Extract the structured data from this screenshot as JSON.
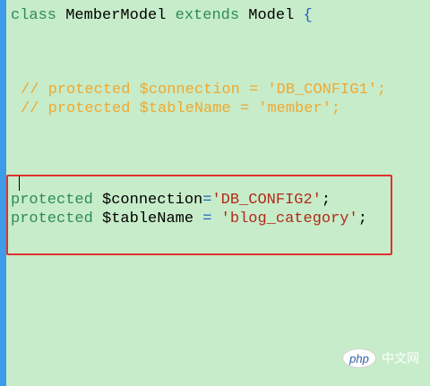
{
  "editor": {
    "line1": {
      "kw_class": "class",
      "name": "MemberModel",
      "kw_extends": "extends",
      "parent": "Model",
      "brace": "{"
    },
    "comment1": "// protected $connection = 'DB_CONFIG1';",
    "comment2": "// protected $tableName = 'member';",
    "code1": {
      "kw": "protected",
      "var": "$connection",
      "op": "=",
      "str": "'DB_CONFIG2'",
      "end": ";"
    },
    "code2": {
      "kw": "protected",
      "var": "$tableName",
      "op": "=",
      "str": "'blog_category'",
      "end": ";"
    }
  },
  "watermark": {
    "badge": "php",
    "text": "中文网"
  },
  "colors": {
    "background": "#c7ecc9",
    "gutter": "#3d9be9",
    "keyword": "#2e8b57",
    "comment": "#f0a830",
    "string": "#b22a1a",
    "highlight_box": "#e0322c"
  }
}
